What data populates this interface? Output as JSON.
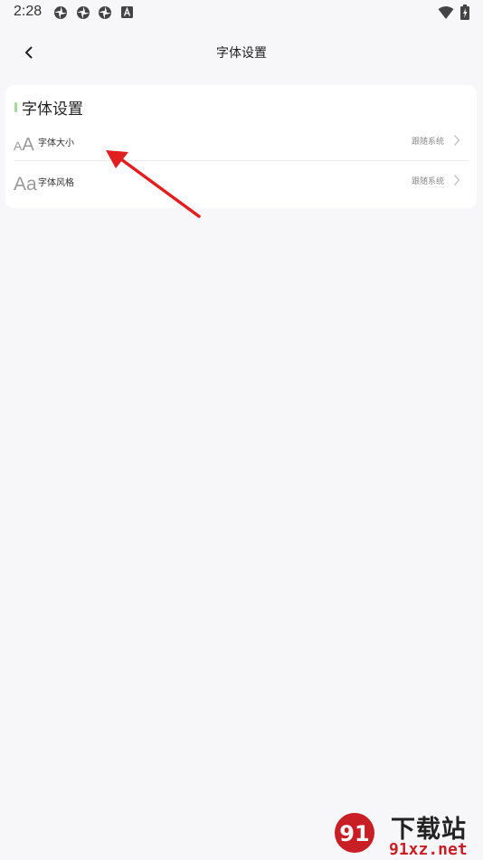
{
  "status_bar": {
    "time": "2:28",
    "icons": [
      "pinwheel-icon",
      "pinwheel-icon",
      "pinwheel-icon",
      "font-app-icon",
      "wifi-icon",
      "battery-icon"
    ]
  },
  "header": {
    "back_icon": "chevron-left-icon",
    "title": "字体设置"
  },
  "section": {
    "title": "字体设置",
    "accent_color": "#9fdc9a",
    "items": [
      {
        "icon_text": "AA",
        "label": "字体大小",
        "value": "跟随系统",
        "icon": "font-size-icon"
      },
      {
        "icon_text": "Aa",
        "label": "字体风格",
        "value": "跟随系统",
        "icon": "font-style-icon"
      }
    ]
  },
  "annotation": {
    "arrow_color": "#e02020"
  },
  "watermark": {
    "logo_text": "91",
    "title": "下载站",
    "url": "91xz.net",
    "brand_color": "#c81e25"
  }
}
